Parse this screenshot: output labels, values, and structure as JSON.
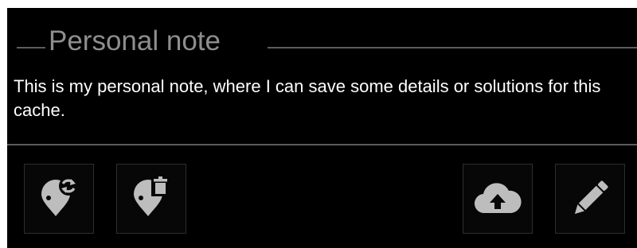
{
  "personal_note": {
    "title": "Personal note",
    "text": "This is my personal note, where I can save some details or solutions for this cache."
  },
  "actions": [
    {
      "name": "sync-note-waypoints-button",
      "icon": "waypoint-sync-icon"
    },
    {
      "name": "delete-note-waypoints-button",
      "icon": "waypoint-delete-icon"
    },
    {
      "name": "upload-note-button",
      "icon": "cloud-upload-icon"
    },
    {
      "name": "edit-note-button",
      "icon": "pencil-icon"
    }
  ],
  "colors": {
    "background": "#000000",
    "header_text": "#8e8e8e",
    "header_rule": "#5c5c5c",
    "body_text": "#ffffff",
    "icon": "#bdbdbd",
    "button_bg": "#070707",
    "button_border": "#2e2e2e"
  }
}
